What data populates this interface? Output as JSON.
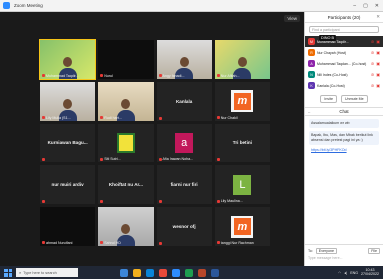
{
  "window": {
    "title": "Zoom Meeting"
  },
  "gallery": {
    "view_label": "View",
    "tiles": [
      {
        "type": "video",
        "bg": "bg-green",
        "name": "Muhammad Taqdir...",
        "active": true
      },
      {
        "type": "video",
        "bg": "bg-dark",
        "name": "Nurul"
      },
      {
        "type": "video",
        "bg": "bg-room",
        "name": "Angy fanadi..."
      },
      {
        "type": "video",
        "bg": "bg-yellow",
        "name": "Nur Afifah..."
      },
      {
        "type": "video",
        "bg": "bg-room",
        "name": "Lily Mulia (S1..."
      },
      {
        "type": "video",
        "bg": "bg-beige",
        "name": "Rudi hart..."
      },
      {
        "type": "text",
        "label": "Kanlala",
        "name": ""
      },
      {
        "type": "logo",
        "name": "Nur Chakil"
      },
      {
        "type": "text",
        "label": "Kurniawan Bagu...",
        "name": ""
      },
      {
        "type": "logo-yellow",
        "name": "Siti Sutri..."
      },
      {
        "type": "letter",
        "letter": "a",
        "color": "#c2185b",
        "name": "Afia Irawan Noha..."
      },
      {
        "type": "text",
        "label": "Tri betini",
        "name": ""
      },
      {
        "type": "text",
        "label": "nur muiri ardiv",
        "name": ""
      },
      {
        "type": "text",
        "label": "Khoiftat nu Ar...",
        "name": ""
      },
      {
        "type": "text",
        "label": "fiarni nur firi",
        "name": ""
      },
      {
        "type": "letter",
        "letter": "L",
        "color": "#7cb342",
        "name": "Lily Maulina..."
      },
      {
        "type": "video",
        "bg": "bg-dark",
        "name": "ahmad Nurulfani"
      },
      {
        "type": "video",
        "bg": "bg-gray",
        "name": "Sahrul HD"
      },
      {
        "type": "text",
        "label": "wesnor ofj",
        "name": ""
      },
      {
        "type": "logo",
        "name": "tanggi Nur Rachman"
      }
    ]
  },
  "participants": {
    "title": "Participants (20)",
    "search_placeholder": "Find a participant",
    "chip_label": "DINO B",
    "rows": [
      {
        "initial": "M",
        "color": "#e53935",
        "name": "Muhammad Taqdir..."
      },
      {
        "initial": "R",
        "color": "#ef6c00",
        "name": "Nur Chayah (Host)"
      },
      {
        "initial": "A",
        "color": "#8e24aa",
        "name": "Muhammad Taqdan... (Co-host)"
      },
      {
        "initial": "N",
        "color": "#00897b",
        "name": "Nili Indes (Co-Host)"
      },
      {
        "initial": "K",
        "color": "#5e35b1",
        "name": "Kanlala (Co-Host)"
      }
    ],
    "invite_label": "Invite",
    "unmute_label": "Unmute Me"
  },
  "chat": {
    "title": "Chat",
    "messages": [
      "Assalamualaikum wr wb",
      "Bapak, Ibu, Mas, dan Mbak berikut link absensi dan pretest pagi ini ya :)",
      "https://bit.ly/3PHFKOd"
    ],
    "to_label": "To:",
    "to_value": "Everyone",
    "file_label": "File",
    "input_placeholder": "Type message here..."
  },
  "taskbar": {
    "search_placeholder": "Type here to search",
    "time": "10:43",
    "date": "27/04/2022",
    "lang": "ENG"
  }
}
